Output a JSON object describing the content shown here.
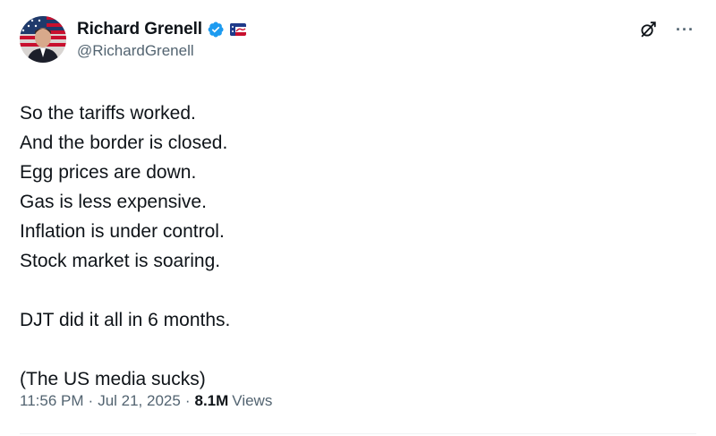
{
  "author": {
    "display_name": "Richard Grenell",
    "handle": "@RichardGrenell",
    "avatar_icon": "avatar-photo",
    "verified_icon": "verified-badge-icon",
    "affiliation_icon": "affiliation-badge-icon",
    "verified_color": "#1d9bf0"
  },
  "actions": {
    "grok_icon": "grok-icon",
    "more_icon": "more-options-icon",
    "more_glyph": "···"
  },
  "body": {
    "lines": [
      "So the tariffs worked.",
      "And the border is closed.",
      "Egg prices are down.",
      "Gas is less expensive.",
      "Inflation is under control.",
      "Stock market is soaring.",
      "",
      "DJT did it all in 6 months.",
      "",
      "(The US media sucks)"
    ]
  },
  "meta": {
    "time": "11:56 PM",
    "separator": "·",
    "date": "Jul 21, 2025",
    "views_count": "8.1M",
    "views_label": "Views"
  }
}
